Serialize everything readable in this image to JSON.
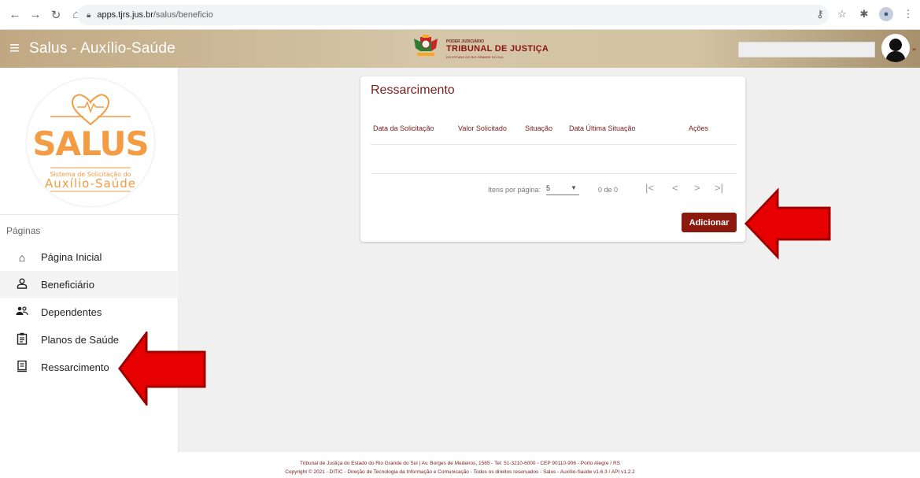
{
  "browser": {
    "url_domain": "apps.tjrs.jus.br",
    "url_path": "/salus/beneficio"
  },
  "header": {
    "app_title": "Salus - Auxílio-Saúde",
    "logo_small": "PODER JUDICIÁRIO",
    "logo_main": "TRIBUNAL DE JUSTIÇA",
    "logo_sub": "DO ESTADO DO RIO GRANDE DO SUL"
  },
  "sidebar": {
    "logo": {
      "title": "SALUS",
      "sub1": "Sistema de Solicitação do",
      "sub2": "Auxílio-Saúde"
    },
    "pages_label": "Páginas",
    "items": [
      {
        "label": "Página Inicial",
        "icon": "home-icon"
      },
      {
        "label": "Beneficiário",
        "icon": "person-icon"
      },
      {
        "label": "Dependentes",
        "icon": "people-icon"
      },
      {
        "label": "Planos de Saúde",
        "icon": "clipboard-icon"
      },
      {
        "label": "Ressarcimento",
        "icon": "receipt-icon"
      }
    ]
  },
  "card": {
    "title": "Ressarcimento",
    "columns": [
      "Data da Solicitação",
      "Valor Solicitado",
      "Situação",
      "Data Última Situação",
      "Ações"
    ],
    "paginator": {
      "label": "Itens por página:",
      "page_size": "5",
      "range": "0 de 0"
    },
    "add_label": "Adicionar"
  },
  "footer": {
    "line1": "Tribunal de Justiça do Estado do Rio Grande do Sul | Av. Borges de Medeiros, 1565 - Tel: 51-3210-6000 - CEP 90110-906 - Porto Alegre / RS",
    "line2": "Copyright © 2021 - DITIC - Direção de Tecnologia da Informação e Comunicação - Todos os direitos reservados - Salus - Auxílio-Saúde v1.6.3 / API v1.2.2"
  },
  "colors": {
    "accent": "#8b1a0e",
    "arrow": "#e00000",
    "header": "#c9b48f"
  }
}
